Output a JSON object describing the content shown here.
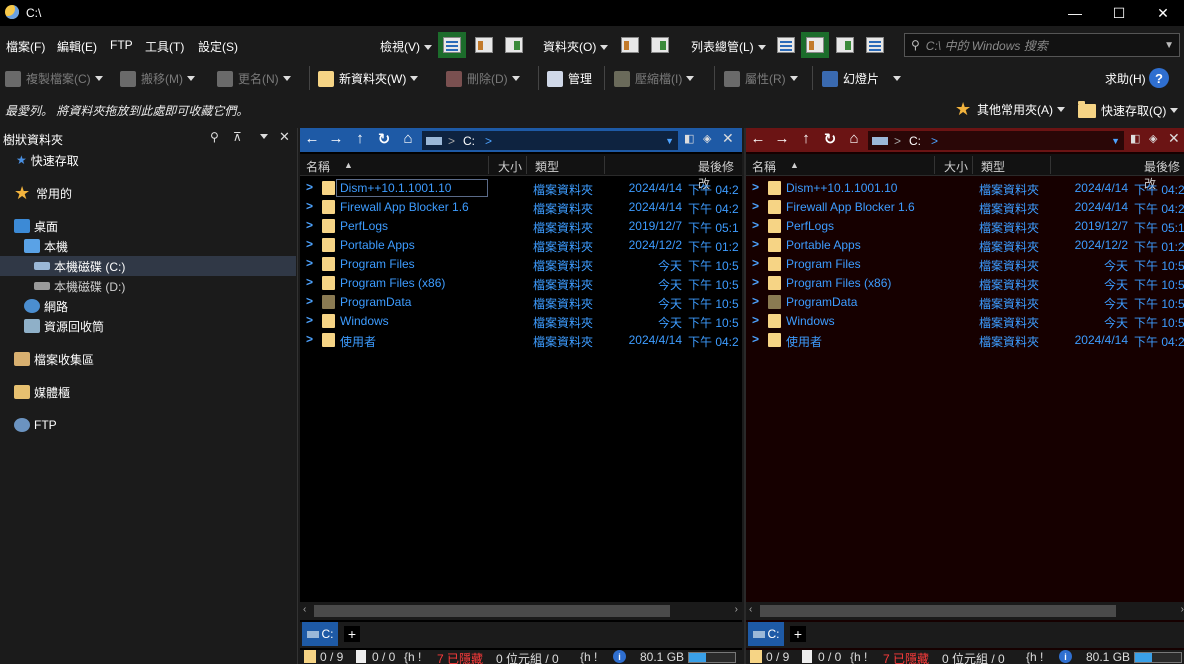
{
  "window": {
    "title": "C:\\",
    "min": "—",
    "max": "☐",
    "close": "✕"
  },
  "menu": {
    "items": [
      "檔案(F)",
      "編輯(E)",
      "FTP",
      "工具(T)",
      "設定(S)"
    ],
    "view": "檢視(V)",
    "folders": "資料夾(O)",
    "listview": "列表總管(L)"
  },
  "search": {
    "placeholder": "C:\\ 中的 Windows 搜索"
  },
  "toolbar": {
    "copy": "複製檔案(C)",
    "move": "搬移(M)",
    "rename": "更名(N)",
    "newfolder": "新資料夾(W)",
    "delete": "刪除(D)",
    "manage": "管理",
    "zip": "壓縮檔(I)",
    "props": "屬性(R)",
    "slideshow": "幻燈片",
    "help": "求助(H)",
    "help_icon": "?"
  },
  "favbar": {
    "hint": "最愛列。 將資料夾拖放到此處即可收藏它們。",
    "other": "其他常用夾(A)",
    "quick": "快速存取(Q)"
  },
  "tree": {
    "header": "樹狀資料夾",
    "items": [
      {
        "label": "快速存取"
      },
      {
        "label": "常用的"
      },
      {
        "label": "桌面"
      },
      {
        "label": "本機"
      },
      {
        "label": "本機磁碟 (C:)"
      },
      {
        "label": "本機磁碟 (D:)"
      },
      {
        "label": "網路"
      },
      {
        "label": "資源回收筒"
      },
      {
        "label": "檔案收集區"
      },
      {
        "label": "媒體櫃"
      },
      {
        "label": "FTP"
      }
    ]
  },
  "pane": {
    "address": "C:",
    "sep": ">",
    "columns": {
      "name": "名稱",
      "size": "大小",
      "type": "類型",
      "modified": "最後修改"
    },
    "files": [
      {
        "name": "Dism++10.1.1001.10",
        "type": "檔案資料夾",
        "date": "2024/4/14",
        "time": "下午 04:2"
      },
      {
        "name": "Firewall App Blocker 1.6",
        "type": "檔案資料夾",
        "date": "2024/4/14",
        "time": "下午 04:2"
      },
      {
        "name": "PerfLogs",
        "type": "檔案資料夾",
        "date": "2019/12/7",
        "time": "下午 05:1"
      },
      {
        "name": "Portable Apps",
        "type": "檔案資料夾",
        "date": "2024/12/2",
        "time": "下午 01:2"
      },
      {
        "name": "Program Files",
        "type": "檔案資料夾",
        "date": "今天",
        "time": "下午 10:5"
      },
      {
        "name": "Program Files (x86)",
        "type": "檔案資料夾",
        "date": "今天",
        "time": "下午 10:5"
      },
      {
        "name": "ProgramData",
        "type": "檔案資料夾",
        "date": "今天",
        "time": "下午 10:5"
      },
      {
        "name": "Windows",
        "type": "檔案資料夾",
        "date": "今天",
        "time": "下午 10:5"
      },
      {
        "name": "使用者",
        "type": "檔案資料夾",
        "date": "2024/4/14",
        "time": "下午 04:2"
      }
    ],
    "tab": "C:",
    "plus": "+",
    "status": {
      "folders": "0 / 9",
      "files": "0 / 0",
      "h1": "{h !",
      "hidden": "7 已隱藏",
      "bytes": "0 位元組 / 0",
      "h2": "{h !",
      "free": "80.1 GB",
      "disk_used_fraction": 0.38
    }
  },
  "colors": {
    "left_accent": "#1e5aa6",
    "right_accent": "#6b1414",
    "right_bg": "#160000",
    "link": "#3d9cff"
  }
}
